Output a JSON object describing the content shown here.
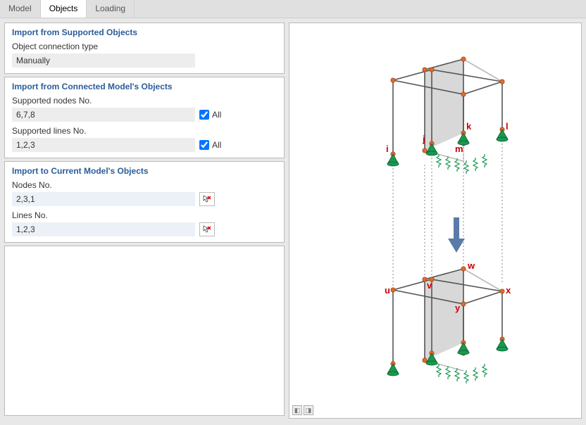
{
  "tabs": [
    "Model",
    "Objects",
    "Loading"
  ],
  "activeTab": 1,
  "group1": {
    "title": "Import from Supported Objects",
    "connTypeLabel": "Object connection type",
    "connTypeValue": "Manually"
  },
  "group2": {
    "title": "Import from Connected Model's Objects",
    "nodesLabel": "Supported nodes No.",
    "nodesValue": "6,7,8",
    "linesLabel": "Supported lines No.",
    "linesValue": "1,2,3",
    "allLabel": "All"
  },
  "group3": {
    "title": "Import to Current Model's Objects",
    "nodesLabel": "Nodes No.",
    "nodesValue": "2,3,1",
    "linesLabel": "Lines No.",
    "linesValue": "1,2,3"
  },
  "diagram": {
    "top": {
      "i": "i",
      "j": "j",
      "k": "k",
      "l": "l",
      "m": "m"
    },
    "bot": {
      "u": "u",
      "v": "v",
      "w": "w",
      "x": "x",
      "y": "y"
    }
  }
}
